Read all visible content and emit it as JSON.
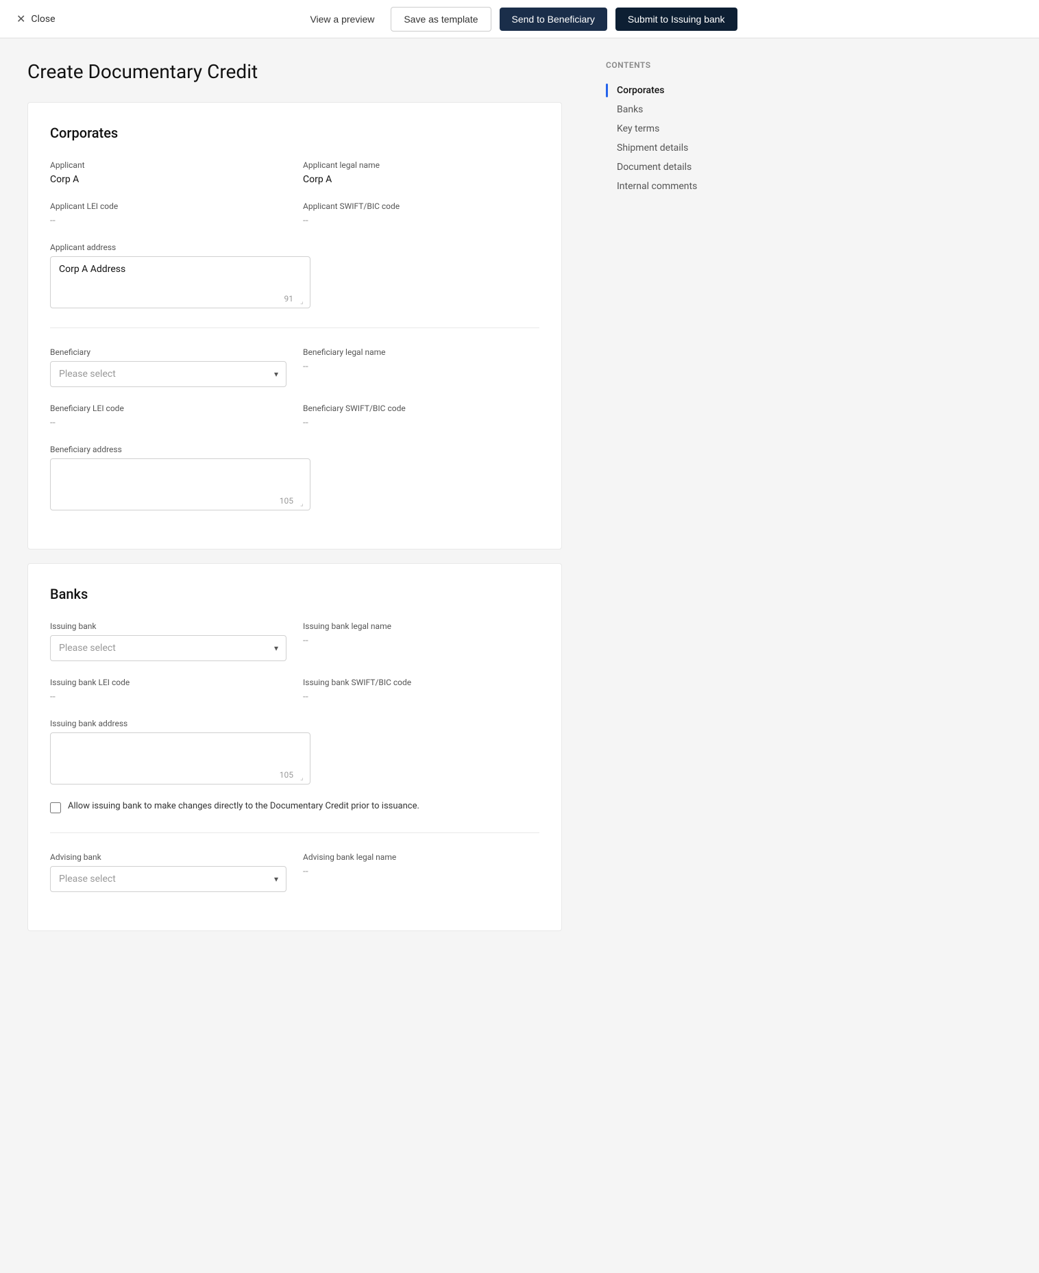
{
  "topBar": {
    "closeLabel": "Close",
    "viewPreviewLabel": "View a preview",
    "saveTemplateLabel": "Save as template",
    "sendBeneficiaryLabel": "Send to Beneficiary",
    "submitIssuingLabel": "Submit to Issuing bank"
  },
  "pageTitle": "Create Documentary Credit",
  "sidebar": {
    "contentsLabel": "Contents",
    "items": [
      {
        "id": "corporates",
        "label": "Corporates",
        "active": true
      },
      {
        "id": "banks",
        "label": "Banks",
        "active": false
      },
      {
        "id": "key-terms",
        "label": "Key terms",
        "active": false
      },
      {
        "id": "shipment-details",
        "label": "Shipment details",
        "active": false
      },
      {
        "id": "document-details",
        "label": "Document details",
        "active": false
      },
      {
        "id": "internal-comments",
        "label": "Internal comments",
        "active": false
      }
    ]
  },
  "corporatesSection": {
    "title": "Corporates",
    "applicantLabel": "Applicant",
    "applicantValue": "Corp A",
    "applicantLegalNameLabel": "Applicant legal name",
    "applicantLegalNameValue": "Corp A",
    "applicantLEILabel": "Applicant LEI code",
    "applicantLEIValue": "--",
    "applicantSWIFTLabel": "Applicant SWIFT/BIC code",
    "applicantSWIFTValue": "--",
    "applicantAddressLabel": "Applicant address",
    "applicantAddressValue": "Corp A Address",
    "applicantAddressCharCount": "91",
    "beneficiaryLabel": "Beneficiary",
    "beneficiaryPlaceholder": "Please select",
    "beneficiaryLegalNameLabel": "Beneficiary legal name",
    "beneficiaryLegalNameValue": "--",
    "beneficiaryLEILabel": "Beneficiary LEI code",
    "beneficiaryLEIValue": "--",
    "beneficiarySWIFTLabel": "Beneficiary SWIFT/BIC code",
    "beneficiarySWIFTValue": "--",
    "beneficiaryAddressLabel": "Beneficiary address",
    "beneficiaryAddressCharCount": "105"
  },
  "banksSection": {
    "title": "Banks",
    "issuingBankLabel": "Issuing bank",
    "issuingBankPlaceholder": "Please select",
    "issuingBankLegalNameLabel": "Issuing bank legal name",
    "issuingBankLegalNameValue": "--",
    "issuingBankLEILabel": "Issuing bank LEI code",
    "issuingBankLEIValue": "--",
    "issuingBankSWIFTLabel": "Issuing bank SWIFT/BIC code",
    "issuingBankSWIFTValue": "--",
    "issuingBankAddressLabel": "Issuing bank address",
    "issuingBankAddressCharCount": "105",
    "checkboxLabel": "Allow issuing bank to make changes directly to the Documentary Credit prior to issuance.",
    "advisingBankLabel": "Advising bank",
    "advisingBankPlaceholder": "Please select",
    "advisingBankLegalNameLabel": "Advising bank legal name",
    "advisingBankLegalNameValue": "--"
  },
  "icons": {
    "close": "✕",
    "chevronDown": "▾",
    "resizeHandle": "⌟"
  }
}
